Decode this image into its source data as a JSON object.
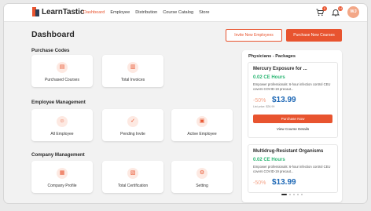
{
  "brand": {
    "name": "LearnTastic"
  },
  "nav": {
    "items": [
      {
        "label": "Dashboard",
        "active": true
      },
      {
        "label": "Employee",
        "active": false
      },
      {
        "label": "Distribution",
        "active": false
      },
      {
        "label": "Course Catalog",
        "active": false
      },
      {
        "label": "Store",
        "active": false
      }
    ]
  },
  "header": {
    "cart_badge": "0",
    "bell_badge": "14",
    "avatar_initials": "WJ"
  },
  "page": {
    "title": "Dashboard",
    "invite_button": "Invite New Employees",
    "purchase_button": "Purchase New Courses"
  },
  "sections": {
    "purchase_codes": {
      "label": "Purchase Codes",
      "cards": [
        "Purchased Courses",
        "Total Invoices"
      ]
    },
    "employee_management": {
      "label": "Employee Management",
      "cards": [
        "All Employee",
        "Pending Invite",
        "Active Employee"
      ]
    },
    "company_management": {
      "label": "Company Management",
      "cards": [
        "Company Profile",
        "Total Certification",
        "Setting"
      ]
    }
  },
  "packages_panel": {
    "title": "Physicians -  Packages",
    "cards": [
      {
        "title": "Mercury Exposure for ...",
        "hours": "0.02 CE Hours",
        "description": "Empower professionals: 6-hour infection control CEU covers COVID-19 precaut...",
        "discount": "-50%",
        "price": "$13.99",
        "list_price": "List price: $26.99",
        "buy_label": "Purchase Now",
        "view_label": "View Course Details"
      },
      {
        "title": "Multidrug-Resistant Organisms",
        "hours": "0.02 CE Hours",
        "description": "Empower professionals: 6-hour infection control CEU covers COVID-19 precaut...",
        "discount": "-50%",
        "price": "$13.99"
      }
    ]
  },
  "colors": {
    "accent": "#e8542f",
    "price_blue": "#1d67b5",
    "hours_green": "#2bb673"
  }
}
